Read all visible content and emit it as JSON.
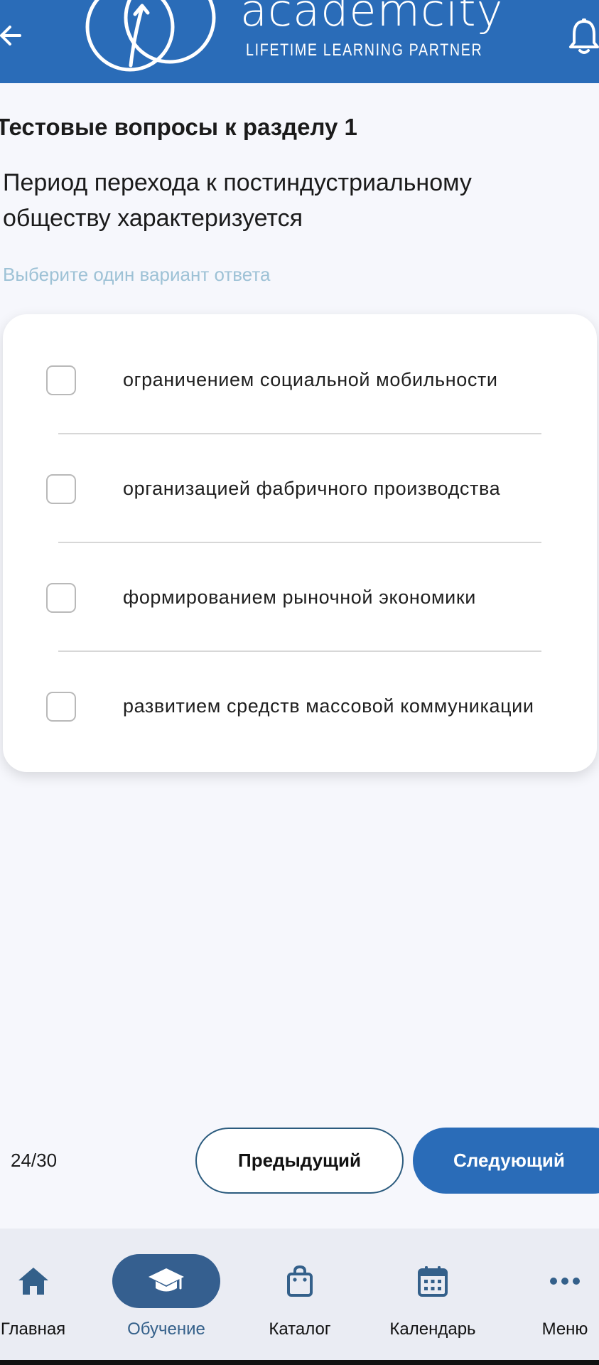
{
  "header": {
    "logo_text": "academcity",
    "tagline": "LIFETIME LEARNING PARTNER",
    "icons": {
      "back": "arrow-left-icon",
      "notifications": "bell-icon"
    }
  },
  "quiz": {
    "section_title": "Тестовые вопросы к разделу 1",
    "question": "Период перехода к постиндустриальному обществу характеризуется",
    "hint": "Выберите один вариант ответа",
    "options": [
      {
        "label": "ограничением социальной мобильности",
        "checked": false
      },
      {
        "label": "организацией фабричного производства",
        "checked": false
      },
      {
        "label": "формированием рыночной экономики",
        "checked": false
      },
      {
        "label": "развитием средств массовой коммуникации",
        "checked": false
      }
    ]
  },
  "navigation": {
    "counter": "24/30",
    "prev_label": "Предыдущий",
    "next_label": "Следующий"
  },
  "tabbar": {
    "items": [
      {
        "label": "Главная",
        "icon": "home-icon",
        "active": false
      },
      {
        "label": "Обучение",
        "icon": "graduation-cap-icon",
        "active": true
      },
      {
        "label": "Каталог",
        "icon": "shopping-bag-icon",
        "active": false
      },
      {
        "label": "Календарь",
        "icon": "calendar-icon",
        "active": false
      },
      {
        "label": "Меню",
        "icon": "more-dots-icon",
        "active": false
      }
    ]
  },
  "colors": {
    "brand_blue": "#2a6cb8",
    "active_tab": "#355f8f",
    "hint": "#9ec2d6",
    "background": "#f6f7fc"
  }
}
